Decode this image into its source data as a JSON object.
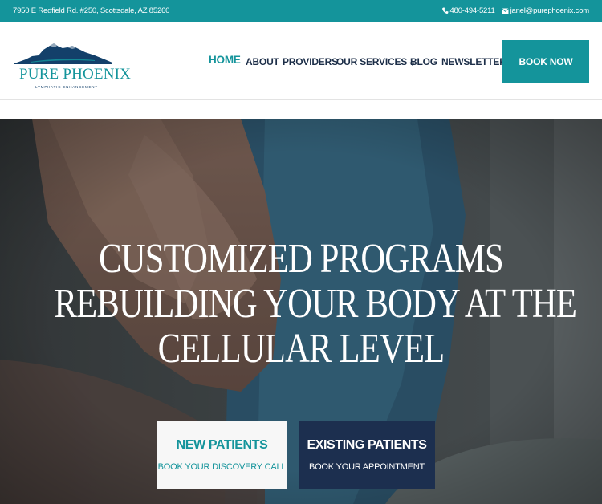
{
  "topbar": {
    "address": "7950 E Redfield Rd. #250, Scottsdale, AZ 85260",
    "phone": "480-494-5211",
    "email": "janel@purephoenix.com",
    "phone_icon": "phone-icon",
    "email_icon": "envelope-icon",
    "background": "#14949b"
  },
  "logo": {
    "brand": "PURE PHOENIX",
    "tagline": "LYMPHATIC ENHANCEMENT",
    "mountain_color": "#13406a"
  },
  "nav": {
    "items": [
      {
        "label": "HOME",
        "active": true
      },
      {
        "label": "ABOUT",
        "active": false
      },
      {
        "label": "PROVIDERS",
        "active": false
      },
      {
        "label": "OUR SERVICES",
        "active": false,
        "dropdown": true
      },
      {
        "label": "BLOG",
        "active": false
      },
      {
        "label": "NEWSLETTER",
        "active": false
      }
    ],
    "book_now": "BOOK NOW",
    "accent": "#14949b"
  },
  "hero": {
    "headline": [
      "CUSTOMIZED PROGRAMS",
      "REBUILDING YOUR BODY AT THE",
      "CELLULAR LEVEL"
    ],
    "cta_new": {
      "title": "NEW PATIENTS",
      "subtitle": "BOOK YOUR DISCOVERY CALL"
    },
    "cta_existing": {
      "title": "EXISTING PATIENTS",
      "subtitle": "BOOK YOUR APPOINTMENT"
    },
    "navy": "#1c2f4f"
  }
}
